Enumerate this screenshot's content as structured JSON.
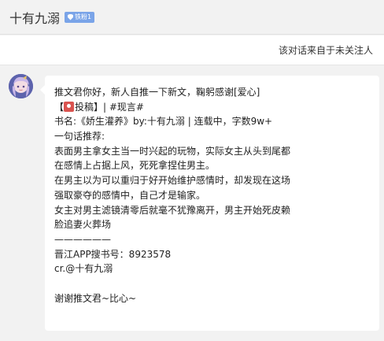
{
  "header": {
    "title": "十有九溺",
    "badge": "铁粉1"
  },
  "notice": "该对话来自于未关注人",
  "message": {
    "avatar_icon": "anime-girl-avatar-icon",
    "lines": [
      "推文君你好，新人自推一下新文，鞠躬感谢[爱心]",
      "【",
      "投稿】| #现言#",
      "书名:《娇生灌养》by:十有九溺 | 连载中，字数9w+",
      "一句话推荐:",
      "表面男主拿女主当一时兴起的玩物，实际女主从头到尾都",
      "在感情上占据上风，死死拿捏住男主。",
      "在男主以为可以重归于好开始维护感情时，却发现在这场",
      "强取豪夺的感情中，自己才是输家。",
      "女主对男主滤镜清零后就毫不犹豫离开，男主开始死皮赖",
      "脸追妻火葬场",
      "——————",
      "晋江APP搜书号：8923578",
      "cr.@十有九溺",
      "谢谢推文君~比心~"
    ]
  }
}
